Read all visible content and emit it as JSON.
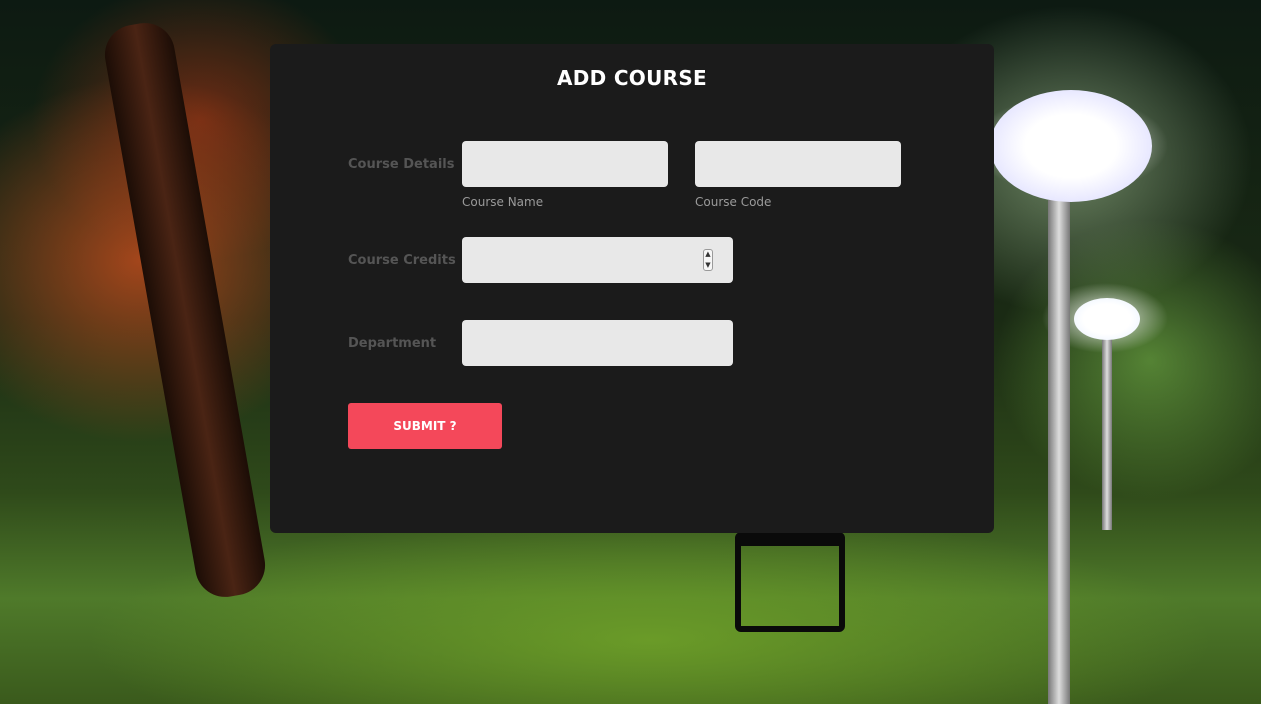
{
  "form": {
    "title": "ADD COURSE",
    "submit_label": "SUBMIT ?",
    "rows": {
      "course_details": {
        "label": "Course Details",
        "course_name": {
          "value": "",
          "caption": "Course Name"
        },
        "course_code": {
          "value": "",
          "caption": "Course Code"
        }
      },
      "course_credits": {
        "label": "Course Credits",
        "value": ""
      },
      "department": {
        "label": "Department",
        "value": ""
      }
    }
  },
  "colors": {
    "card_background": "#1b1b1b",
    "field_background": "#e8e8e8",
    "label_text": "#555555",
    "caption_text": "#9a9a9a",
    "submit_button": "#f4485a"
  },
  "icons": {
    "spinner": "up-down-arrows-icon"
  }
}
